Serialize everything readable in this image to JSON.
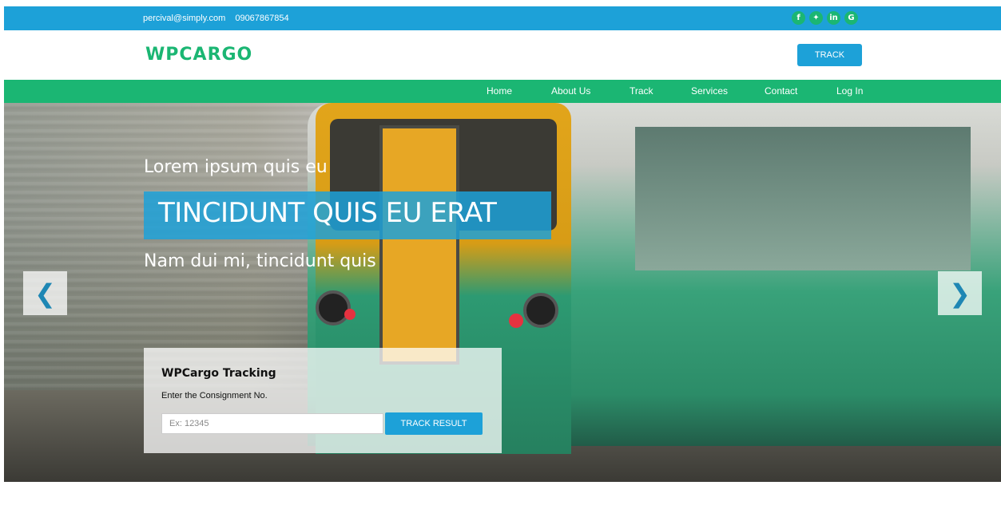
{
  "topbar": {
    "email": "percival@simply.com",
    "phone": "09067867854",
    "social": [
      {
        "icon": "facebook-icon",
        "glyph": "f"
      },
      {
        "icon": "twitter-icon",
        "glyph": "✔"
      },
      {
        "icon": "linkedin-icon",
        "glyph": "in"
      },
      {
        "icon": "google-icon",
        "glyph": "G"
      }
    ]
  },
  "header": {
    "logo": "WPCARGO",
    "track_label": "TRACK"
  },
  "nav": {
    "items": [
      "Home",
      "About Us",
      "Track",
      "Services",
      "Contact",
      "Log In"
    ]
  },
  "hero": {
    "small": "Lorem ipsum quis eu",
    "big": "TINCIDUNT QUIS EU ERAT",
    "sub": "Nam dui mi, tincidunt quis",
    "prev_glyph": "❮",
    "next_glyph": "❯"
  },
  "tracking": {
    "title": "WPCargo Tracking",
    "label": "Enter the Consignment No.",
    "placeholder": "Ex: 12345",
    "submit": "TRACK RESULT"
  },
  "colors": {
    "blue": "#1da1d8",
    "green": "#1bb673"
  }
}
